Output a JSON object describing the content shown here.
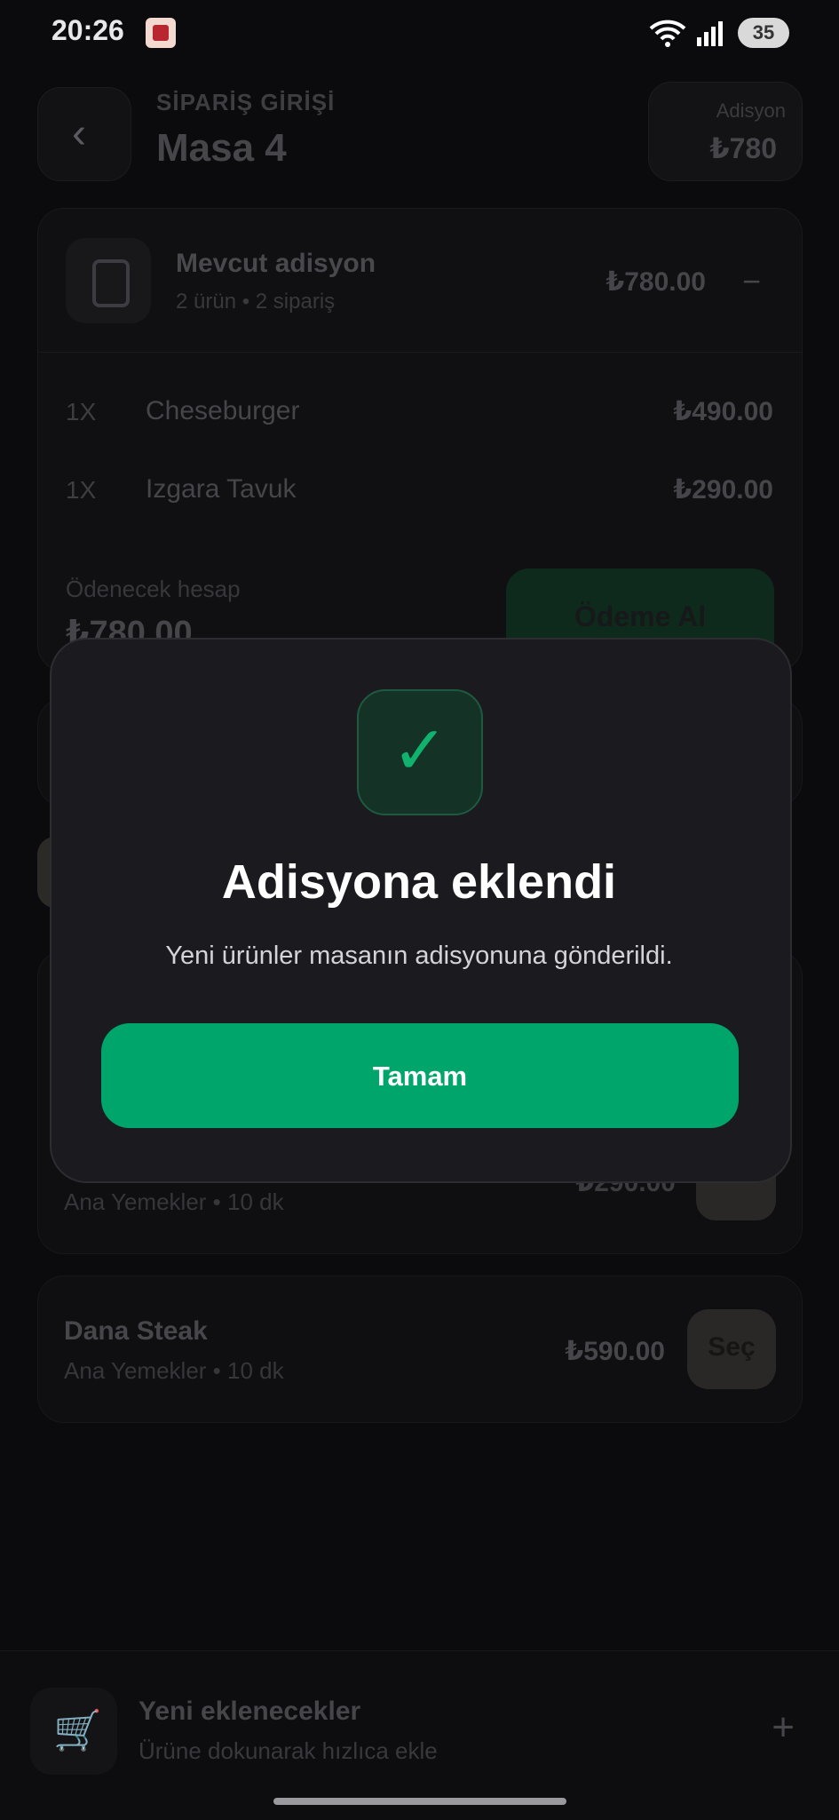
{
  "status_bar": {
    "time": "20:26",
    "battery": "35"
  },
  "header": {
    "subtitle": "SİPARİŞ GİRİŞİ",
    "title": "Masa 4",
    "total_label": "Adisyon",
    "total_value": "₺780"
  },
  "current_bill": {
    "title": "Mevcut adisyon",
    "subtitle": "2 ürün • 2 sipariş",
    "amount": "₺780.00",
    "collapse_symbol": "−",
    "items": [
      {
        "qty": "1X",
        "name": "Cheseburger",
        "price": "₺490.00"
      },
      {
        "qty": "1X",
        "name": "Izgara Tavuk",
        "price": "₺290.00"
      }
    ],
    "payable_label": "Ödenecek hesap",
    "payable_value": "₺780.00",
    "pay_button": "Ödeme Al"
  },
  "products": [
    {
      "meta": "Ana Yemekler • 10 dk",
      "price": "₺290.00",
      "button": "+"
    },
    {
      "name": "Dana Steak",
      "meta": "Ana Yemekler • 10 dk",
      "price": "₺590.00",
      "button": "Seç"
    }
  ],
  "bottom_bar": {
    "title": "Yeni eklenecekler",
    "subtitle": "Ürüne dokunarak hızlıca ekle",
    "plus": "+"
  },
  "modal": {
    "check": "✓",
    "title": "Adisyona eklendi",
    "message": "Yeni ürünler masanın adisyonuna gönderildi.",
    "button": "Tamam"
  },
  "colors": {
    "accent": "#00a56c",
    "background": "#0b0b0d",
    "modal_bg": "#1b1b1f"
  }
}
